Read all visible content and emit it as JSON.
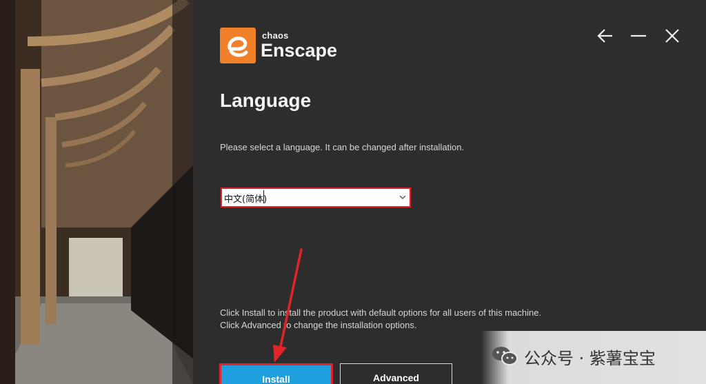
{
  "brand": {
    "company": "chaos",
    "product": "Enscape",
    "logo_color": "#f0802a"
  },
  "window_controls": {
    "back_icon": "arrow-left-icon",
    "minimize_icon": "minimize-icon",
    "close_icon": "close-icon"
  },
  "page": {
    "title": "Language",
    "description": "Please select a language. It can be changed after installation."
  },
  "language_select": {
    "selected": "中文(简体)",
    "dropdown_icon": "chevron-down-icon"
  },
  "info": {
    "line1": "Click Install to install the product with default options for all users of this machine.",
    "line2": "Click Advanced to change the installation options."
  },
  "buttons": {
    "install": "Install",
    "advanced": "Advanced"
  },
  "watermark": {
    "text": "公众号 · 紫薯宝宝"
  },
  "colors": {
    "panel_bg": "#2d2d2d",
    "install_bg": "#1f9fde",
    "highlight": "#e0242a"
  }
}
